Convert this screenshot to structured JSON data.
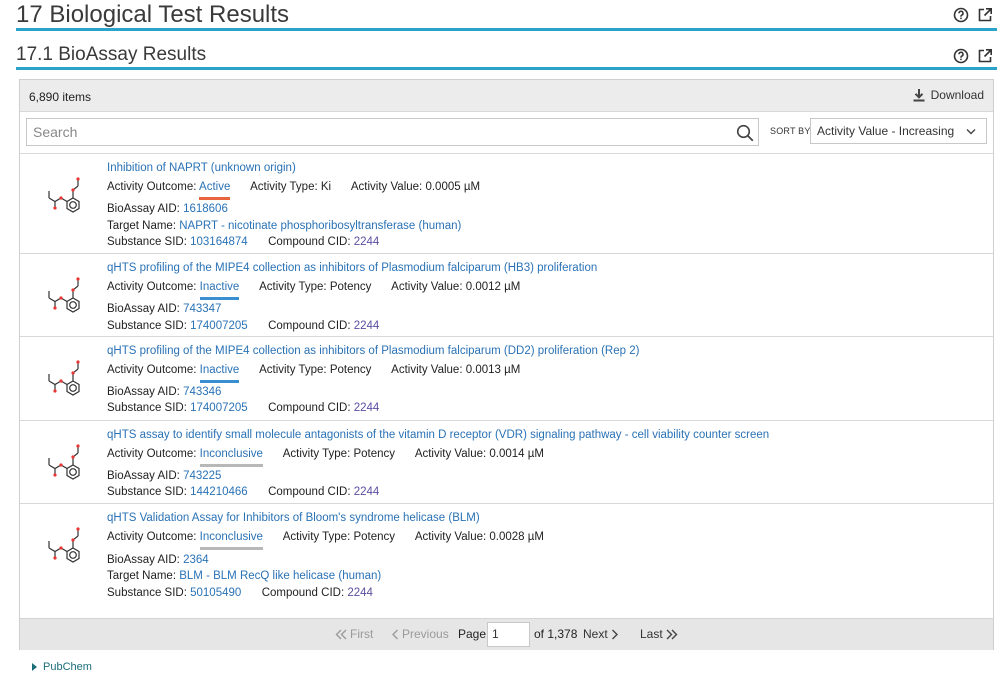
{
  "section": {
    "title": "17 Biological Test Results",
    "subtitle": "17.1 BioAssay Results"
  },
  "panel": {
    "items_count": "6,890 items",
    "download_label": "Download",
    "search_placeholder": "Search",
    "sort_by_label": "SORT BY",
    "sort_value": "Activity Value - Increasing"
  },
  "labels": {
    "activity_outcome": "Activity Outcome:",
    "activity_type": "Activity Type:",
    "activity_value": "Activity Value:",
    "bioassay_aid": "BioAssay AID:",
    "target_name": "Target Name:",
    "substance_sid": "Substance SID:",
    "compound_cid": "Compound CID:"
  },
  "results": [
    {
      "title": "Inhibition of NAPRT (unknown origin)",
      "outcome": "Active",
      "outcome_color": "#e8643c",
      "activity_type": "Ki",
      "activity_value": "0.0005 µM",
      "aid": "1618606",
      "target": "NAPRT - nicotinate phosphoribosyltransferase (human)",
      "sid": "103164874",
      "cid": "2244"
    },
    {
      "title": "qHTS profiling of the MIPE4 collection as inhibitors of Plasmodium falciparum (HB3) proliferation",
      "outcome": "Inactive",
      "outcome_color": "#3a8fd0",
      "activity_type": "Potency",
      "activity_value": "0.0012 µM",
      "aid": "743347",
      "sid": "174007205",
      "cid": "2244"
    },
    {
      "title": "qHTS profiling of the MIPE4 collection as inhibitors of Plasmodium falciparum (DD2) proliferation (Rep 2)",
      "outcome": "Inactive",
      "outcome_color": "#3a8fd0",
      "activity_type": "Potency",
      "activity_value": "0.0013 µM",
      "aid": "743346",
      "sid": "174007205",
      "cid": "2244"
    },
    {
      "title": "qHTS assay to identify small molecule antagonists of the vitamin D receptor (VDR) signaling pathway - cell viability counter screen",
      "outcome": "Inconclusive",
      "outcome_color": "#b8b8b8",
      "activity_type": "Potency",
      "activity_value": "0.0014 µM",
      "aid": "743225",
      "sid": "144210466",
      "cid": "2244"
    },
    {
      "title": "qHTS Validation Assay for Inhibitors of Bloom's syndrome helicase (BLM)",
      "outcome": "Inconclusive",
      "outcome_color": "#b8b8b8",
      "activity_type": "Potency",
      "activity_value": "0.0028 µM",
      "aid": "2364",
      "target": "BLM - BLM RecQ like helicase (human)",
      "sid": "50105490",
      "cid": "2244"
    }
  ],
  "pager": {
    "first": "First",
    "previous": "Previous",
    "page_label": "Page",
    "page_value": "1",
    "of_total": "of 1,378",
    "next": "Next",
    "last": "Last"
  },
  "footer": {
    "link": "PubChem"
  },
  "icons": {
    "help": "help-circle-icon",
    "popout": "external-link-icon",
    "download": "download-icon",
    "search": "search-icon",
    "chevron": "chevron-down-icon"
  }
}
